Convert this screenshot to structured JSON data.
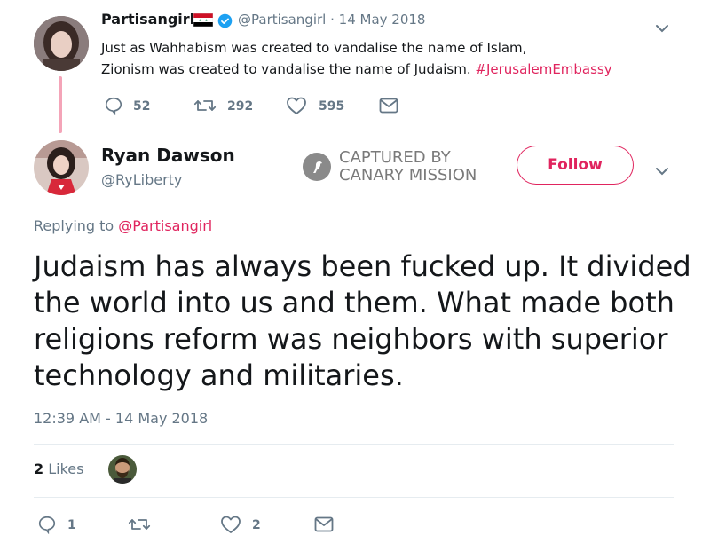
{
  "parent_tweet": {
    "display_name": "Partisangirl",
    "handle": "@Partisangirl",
    "separator": "·",
    "date": "14 May 2018",
    "text_line1": "Just as Wahhabism was created to vandalise the name of Islam,",
    "text_line2": "Zionism was created to vandalise the name of Judaism.",
    "hashtag": "#JerusalemEmbassy",
    "reply_count": "52",
    "retweet_count": "292",
    "like_count": "595"
  },
  "main_tweet": {
    "display_name": "Ryan Dawson",
    "handle": "@RyLiberty",
    "follow_label": "Follow",
    "replying_prefix": "Replying to",
    "replying_to": "@Partisangirl",
    "text_line1": "Judaism has always been fucked up. It divided",
    "text_line2": "the world into us and them. What made both",
    "text_line3": "religions reform was neighbors with superior",
    "text_line4": "technology and militaries.",
    "timestamp": "12:39 AM - 14 May 2018",
    "likes_count": "2",
    "likes_label": "Likes",
    "reply_count": "1",
    "like_count": "2"
  },
  "watermark": {
    "line1": "CAPTURED BY",
    "line2": "CANARY MISSION"
  },
  "colors": {
    "accent": "#e0245e",
    "muted": "#657786",
    "verified": "#1da1f2"
  }
}
